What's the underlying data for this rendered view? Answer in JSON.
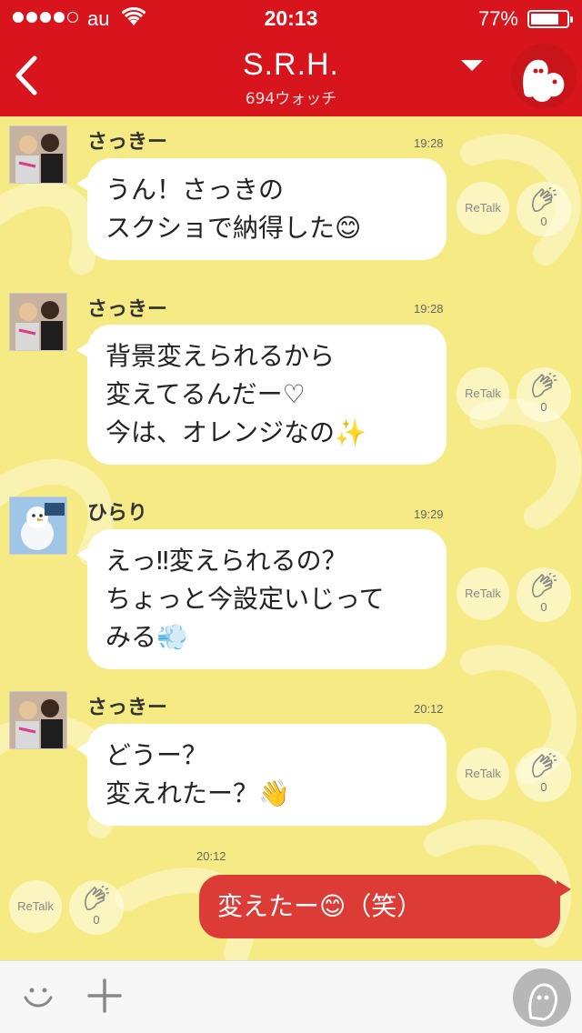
{
  "status": {
    "carrier": "au",
    "time": "20:13",
    "battery": "77%",
    "battery_level": 0.77
  },
  "header": {
    "title": "S.R.H.",
    "subtitle": "694ウォッチ"
  },
  "messages": [
    {
      "sender": "さっきー",
      "time": "19:28",
      "lines": [
        "うん！さっきの",
        "スクショで納得した😊"
      ],
      "retalk": "ReTalk",
      "clap_count": "0"
    },
    {
      "sender": "さっきー",
      "time": "19:28",
      "lines": [
        "背景変えられるから",
        "変えてるんだー♡",
        "今は、オレンジなの✨"
      ],
      "retalk": "ReTalk",
      "clap_count": "0"
    },
    {
      "sender": "ひらり",
      "time": "19:29",
      "lines": [
        "えっ‼変えられるの？",
        "ちょっと今設定いじって",
        "みる💨"
      ],
      "retalk": "ReTalk",
      "clap_count": "0"
    },
    {
      "sender": "さっきー",
      "time": "20:12",
      "lines": [
        "どうー？",
        "変えれたー？👋"
      ],
      "retalk": "ReTalk",
      "clap_count": "0"
    }
  ],
  "outgoing": {
    "time": "20:12",
    "text": "変えたー😊（笑）",
    "retalk": "ReTalk",
    "clap_count": "0"
  },
  "colors": {
    "header": "#d8151c",
    "chat_bg": "#f6ea84",
    "outgoing_bubble": "#dd3b36",
    "incoming_bubble": "#ffffff"
  }
}
